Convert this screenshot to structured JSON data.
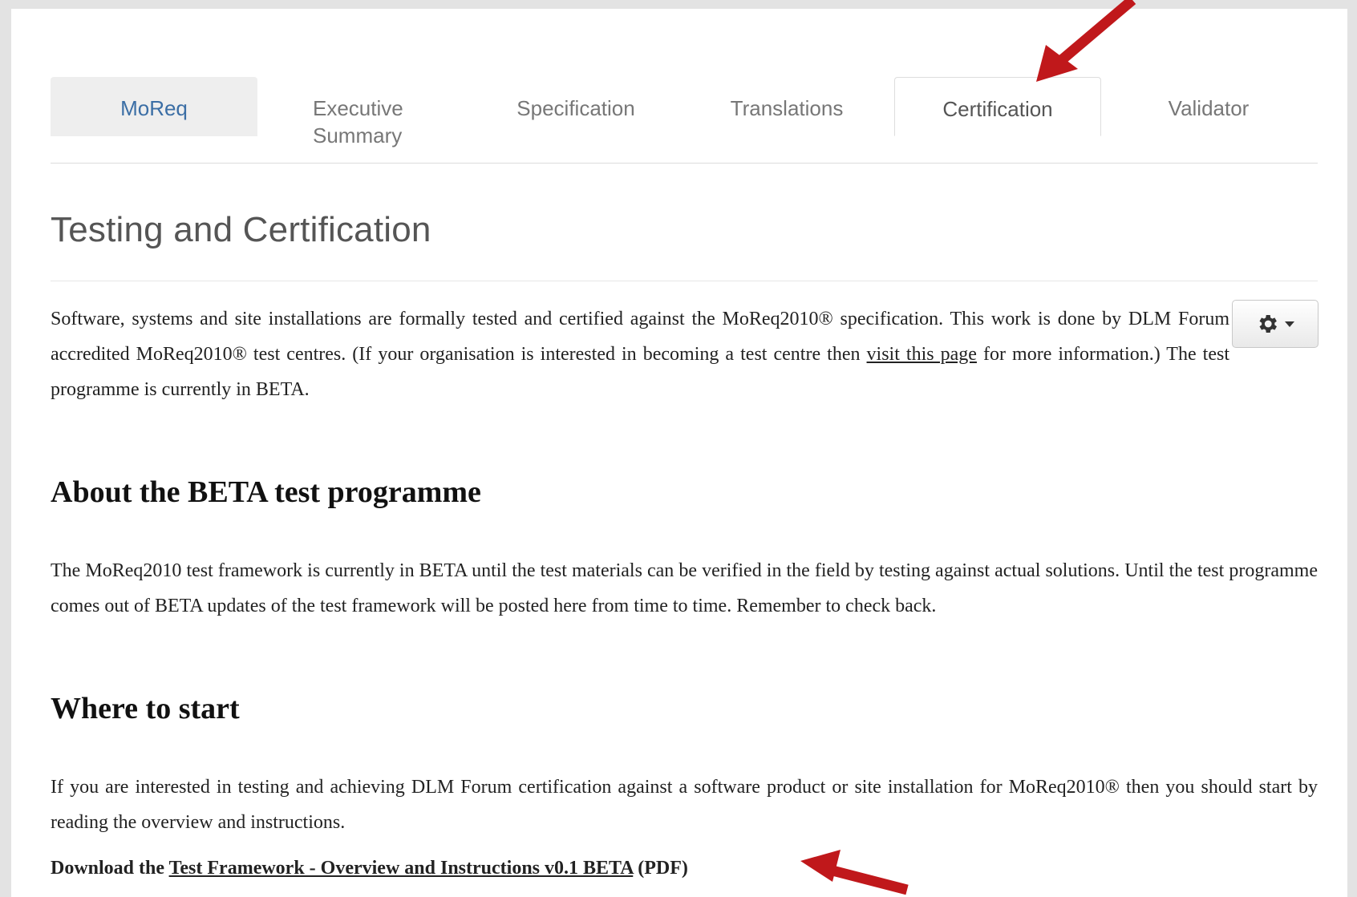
{
  "tabs": [
    {
      "label": "MoReq"
    },
    {
      "label_line1": "Executive",
      "label_line2": "Summary"
    },
    {
      "label": "Specification"
    },
    {
      "label": "Translations"
    },
    {
      "label": "Certification",
      "active": true
    },
    {
      "label": "Validator"
    }
  ],
  "page": {
    "title": "Testing and Certification",
    "intro_before_link": "Software, systems and site installations are formally tested and certified against the MoReq2010® specification. This work is done by DLM Forum accredited MoReq2010® test centres. (If your organisation is interested in becoming a test centre then ",
    "intro_link": "visit this page",
    "intro_after_link": " for more information.) The test programme is currently in BETA.",
    "about_heading": "About the BETA test programme",
    "about_text": "The MoReq2010 test framework is currently in BETA until the test materials can be verified in the field by testing against actual solutions. Until the test programme comes out of BETA updates of the test framework will be posted here from time to time. Remember to check back.",
    "where_heading": "Where to start",
    "where_text": "If you are interested in testing and achieving DLM Forum certification against a software product or site installation for MoReq2010® then you should start by reading the overview and instructions.",
    "download_prefix": "Download the ",
    "download_link": "Test Framework - Overview and Instructions v0.1 BETA",
    "download_suffix": " (PDF)"
  },
  "icons": {
    "settings": "gear-icon",
    "dropdown": "caret-down-icon"
  },
  "colors": {
    "arrow": "#c0181b",
    "active_tab_text": "#555555",
    "first_tab_text": "#3b6ea5"
  }
}
